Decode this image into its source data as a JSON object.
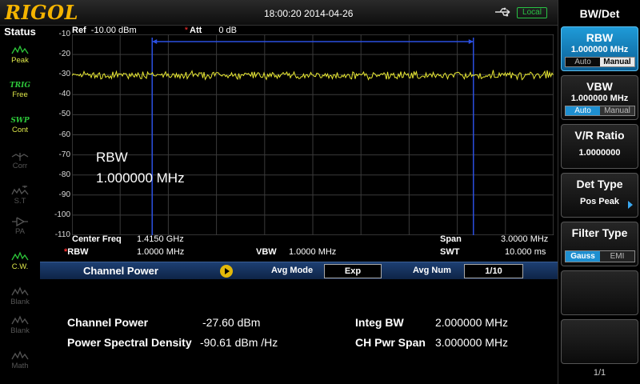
{
  "header": {
    "brand": "RIGOL",
    "datetime": "18:00:20 2014-04-26",
    "remote_status": "Local"
  },
  "status": {
    "title": "Status",
    "items": [
      {
        "top": "",
        "label": "Peak",
        "state": "on"
      },
      {
        "top": "TRIG",
        "label": "Free",
        "state": "on"
      },
      {
        "top": "SWP",
        "label": "Cont",
        "state": "on"
      },
      {
        "top": "",
        "label": "Corr",
        "state": "off"
      },
      {
        "top": "",
        "label": "S.T",
        "state": "off"
      },
      {
        "top": "",
        "label": "PA",
        "state": "off"
      },
      {
        "top": "",
        "label": "C.W.",
        "state": "on"
      },
      {
        "top": "",
        "label": "Blank",
        "state": "off"
      },
      {
        "top": "",
        "label": "Blank",
        "state": "off"
      },
      {
        "top": "",
        "label": "Math",
        "state": "off"
      }
    ]
  },
  "display": {
    "ref_label": "Ref",
    "ref_value": "-10.00 dBm",
    "att_label": "Att",
    "att_value": "0 dB",
    "y_ticks": [
      "-10",
      "-20",
      "-30",
      "-40",
      "-50",
      "-60",
      "-70",
      "-80",
      "-90",
      "-100",
      "-110"
    ],
    "overlay_label": "RBW",
    "overlay_value": "1.000000 MHz",
    "center_freq_label": "Center Freq",
    "center_freq_value": "1.4150 GHz",
    "rbw_label": "RBW",
    "rbw_value": "1.0000 MHz",
    "vbw_label": "VBW",
    "vbw_value": "1.0000 MHz",
    "span_label": "Span",
    "span_value": "3.0000 MHz",
    "swt_label": "SWT",
    "swt_value": "10.000 ms"
  },
  "function_bar": {
    "title": "Channel Power",
    "avg_mode_label": "Avg Mode",
    "avg_mode_value": "Exp",
    "avg_num_label": "Avg Num",
    "avg_num_value": "1/10"
  },
  "results": {
    "channel_power_label": "Channel Power",
    "channel_power_value": "-27.60 dBm",
    "psd_label": "Power Spectral Density",
    "psd_value": "-90.61 dBm /Hz",
    "integ_bw_label": "Integ BW",
    "integ_bw_value": "2.000000 MHz",
    "ch_pwr_span_label": "CH Pwr Span",
    "ch_pwr_span_value": "3.000000 MHz"
  },
  "menu": {
    "title": "BW/Det",
    "rbw": {
      "label": "RBW",
      "value": "1.000000 MHz",
      "opt_auto": "Auto",
      "opt_manual": "Manual",
      "selected": "Manual"
    },
    "vbw": {
      "label": "VBW",
      "value": "1.000000 MHz",
      "opt_auto": "Auto",
      "opt_manual": "Manual",
      "selected": "Auto"
    },
    "vr_ratio": {
      "label": "V/R Ratio",
      "value": "1.0000000"
    },
    "det_type": {
      "label": "Det Type",
      "value": "Pos Peak"
    },
    "filter_type": {
      "label": "Filter Type",
      "opt_gauss": "Gauss",
      "opt_emi": "EMI",
      "selected": "Gauss"
    },
    "page": "1/1"
  },
  "trace": {
    "color": "#e8e832",
    "level_dbm": -30.5,
    "ref_level_dbm": -10,
    "scale_db_per_div": 10,
    "divisions": 10,
    "channel_bw_fraction": 0.667
  }
}
